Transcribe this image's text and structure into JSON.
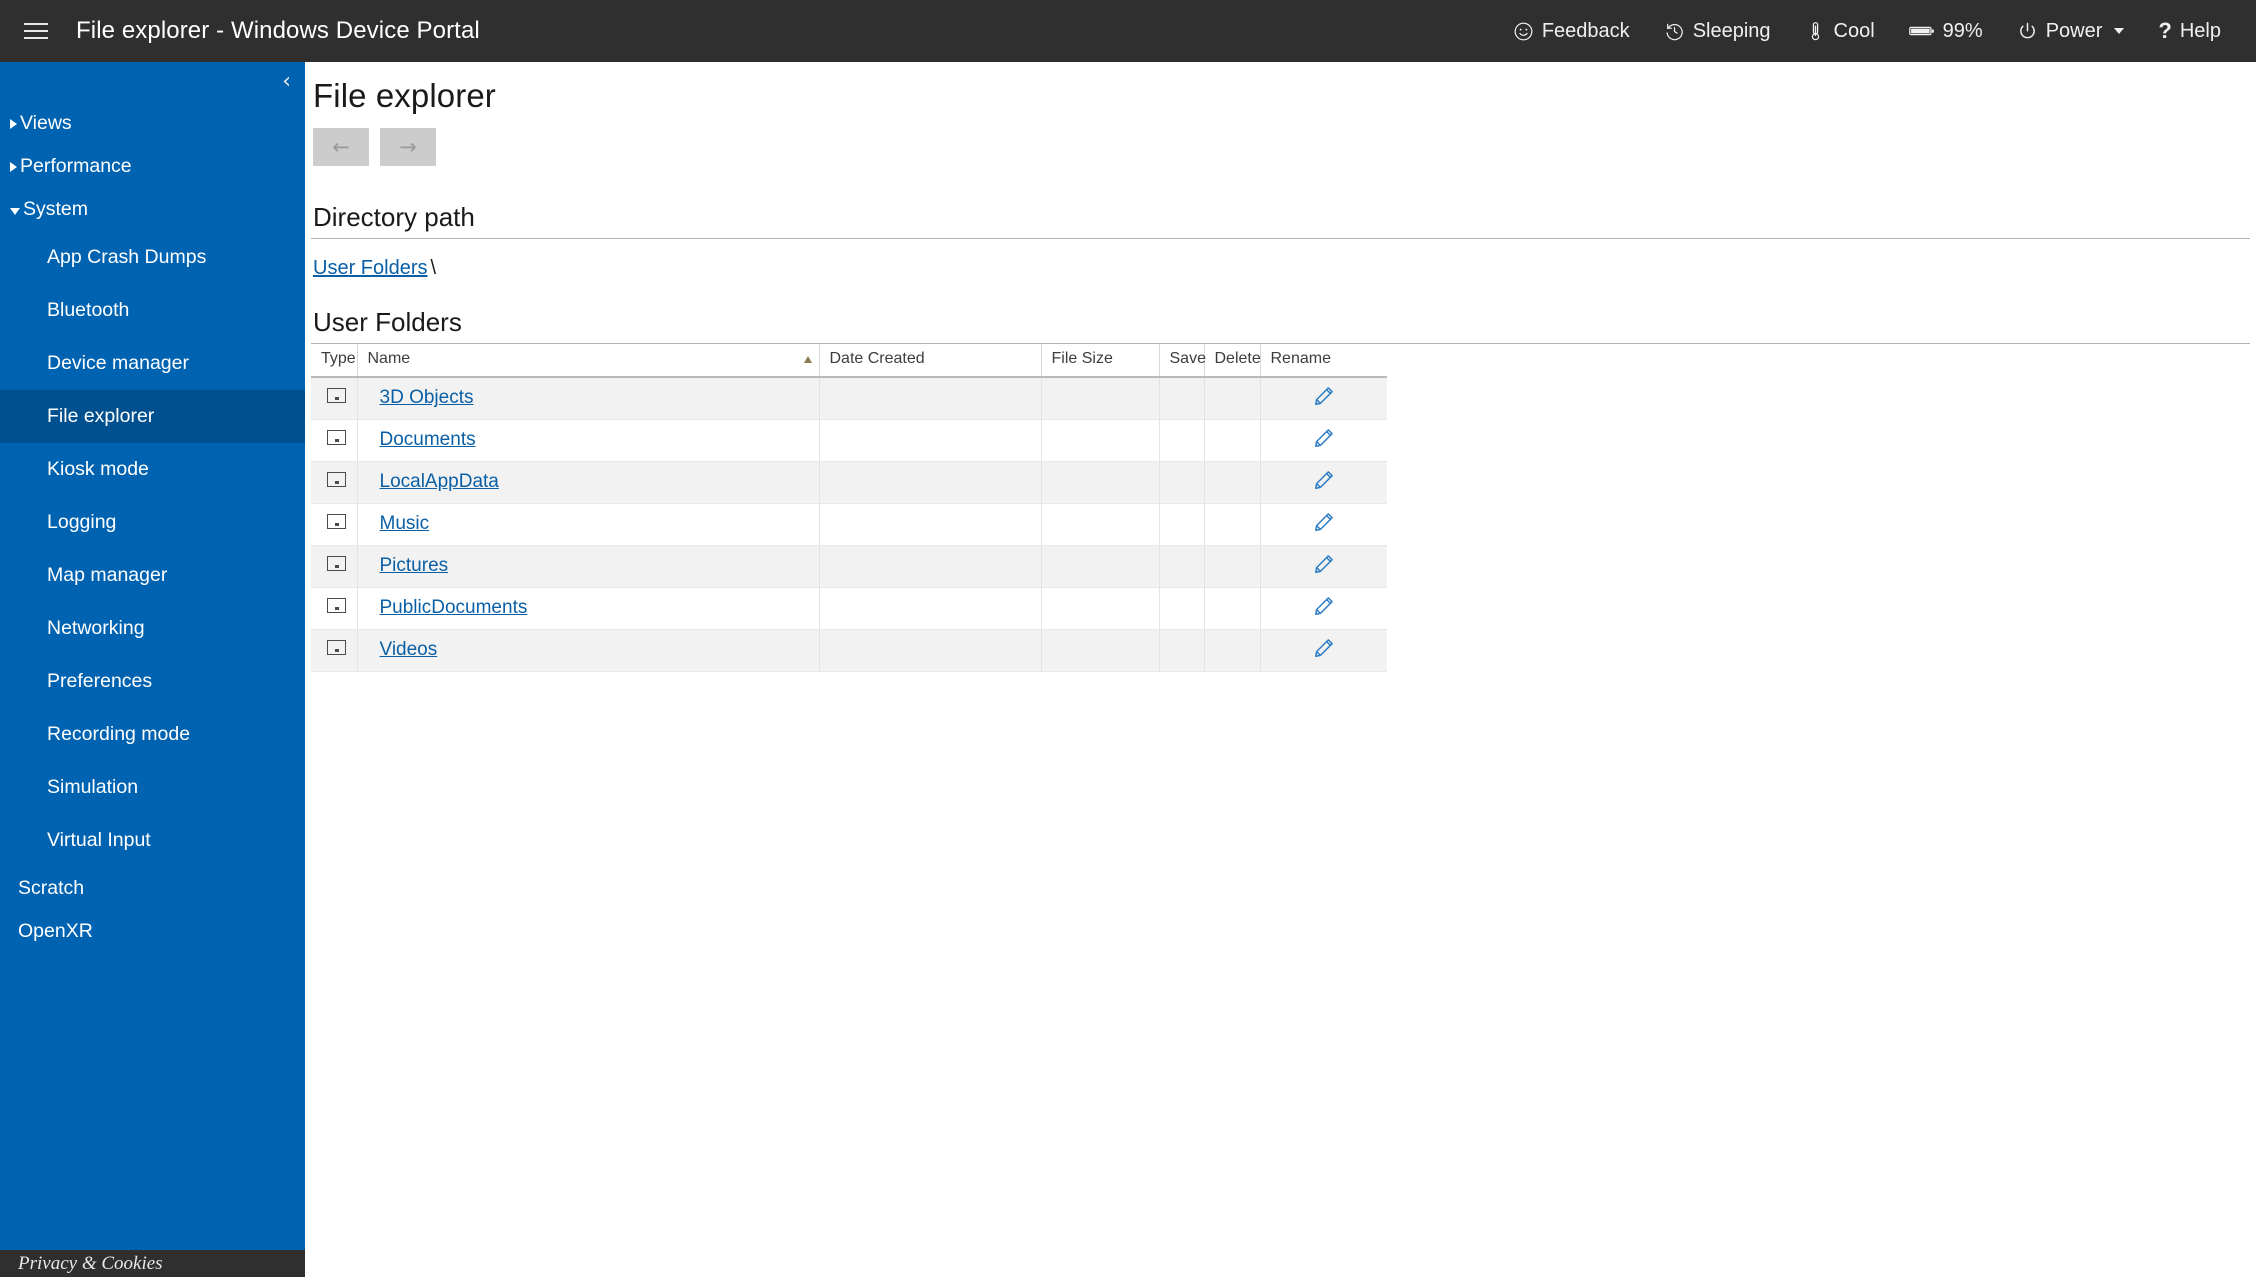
{
  "topbar": {
    "menu_icon": "hamburger-icon",
    "title": "File explorer - Windows Device Portal",
    "items": [
      {
        "icon": "feedback-smiley-icon",
        "label": "Feedback"
      },
      {
        "icon": "clock-history-icon",
        "label": "Sleeping"
      },
      {
        "icon": "thermometer-icon",
        "label": "Cool"
      },
      {
        "icon": "battery-icon",
        "label": "99%"
      },
      {
        "icon": "power-icon",
        "label": "Power",
        "caret": "▾"
      },
      {
        "icon": "question-mark-icon",
        "label": "Help"
      }
    ]
  },
  "sidebar": {
    "collapse_glyph": "‹",
    "groups": [
      {
        "label": "Views",
        "expanded": false
      },
      {
        "label": "Performance",
        "expanded": false
      },
      {
        "label": "System",
        "expanded": true
      }
    ],
    "system_children": [
      {
        "label": "App Crash Dumps",
        "selected": false
      },
      {
        "label": "Bluetooth",
        "selected": false
      },
      {
        "label": "Device manager",
        "selected": false
      },
      {
        "label": "File explorer",
        "selected": true
      },
      {
        "label": "Kiosk mode",
        "selected": false
      },
      {
        "label": "Logging",
        "selected": false
      },
      {
        "label": "Map manager",
        "selected": false
      },
      {
        "label": "Networking",
        "selected": false
      },
      {
        "label": "Preferences",
        "selected": false
      },
      {
        "label": "Recording mode",
        "selected": false
      },
      {
        "label": "Simulation",
        "selected": false
      },
      {
        "label": "Virtual Input",
        "selected": false
      }
    ],
    "top_level": [
      {
        "label": "Scratch"
      },
      {
        "label": "OpenXR"
      }
    ],
    "footer_link": "Privacy & Cookies"
  },
  "main": {
    "page_title": "File explorer",
    "back_label": "←",
    "forward_label": "→",
    "directory_path_heading": "Directory path",
    "breadcrumb": {
      "link": "User Folders",
      "separator": "\\"
    },
    "user_folders_heading": "User Folders",
    "table": {
      "columns": [
        "Type",
        "Name",
        "Date Created",
        "File Size",
        "Save",
        "Delete",
        "Rename"
      ],
      "sorted_by": "Name",
      "sort_direction": "ascending",
      "rows": [
        {
          "type_icon": "folder-icon",
          "name": "3D Objects",
          "date_created": "",
          "file_size": "",
          "save": "",
          "delete": "",
          "rename_icon": "pencil-icon"
        },
        {
          "type_icon": "folder-icon",
          "name": "Documents",
          "date_created": "",
          "file_size": "",
          "save": "",
          "delete": "",
          "rename_icon": "pencil-icon"
        },
        {
          "type_icon": "folder-icon",
          "name": "LocalAppData",
          "date_created": "",
          "file_size": "",
          "save": "",
          "delete": "",
          "rename_icon": "pencil-icon"
        },
        {
          "type_icon": "folder-icon",
          "name": "Music",
          "date_created": "",
          "file_size": "",
          "save": "",
          "delete": "",
          "rename_icon": "pencil-icon"
        },
        {
          "type_icon": "folder-icon",
          "name": "Pictures",
          "date_created": "",
          "file_size": "",
          "save": "",
          "delete": "",
          "rename_icon": "pencil-icon"
        },
        {
          "type_icon": "folder-icon",
          "name": "PublicDocuments",
          "date_created": "",
          "file_size": "",
          "save": "",
          "delete": "",
          "rename_icon": "pencil-icon"
        },
        {
          "type_icon": "folder-icon",
          "name": "Videos",
          "date_created": "",
          "file_size": "",
          "save": "",
          "delete": "",
          "rename_icon": "pencil-icon"
        }
      ]
    }
  },
  "colors": {
    "topbar_bg": "#2f2f2f",
    "sidebar_bg": "#0063b1",
    "sidebar_selected_bg": "#00508f",
    "link_blue": "#0a5fa6",
    "row_stripe": "#f2f2f2",
    "disabled_button": "#cccccc"
  }
}
